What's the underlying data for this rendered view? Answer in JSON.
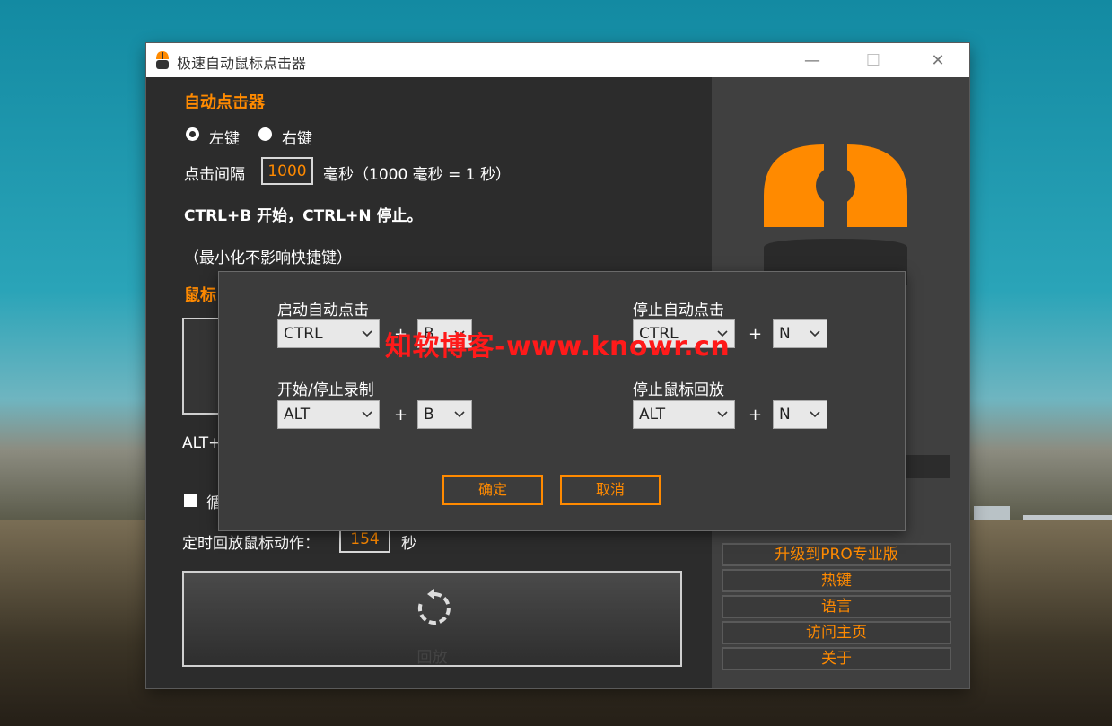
{
  "window": {
    "title": "极速自动鼠标点击器",
    "minimize": "—",
    "maximize": "☐",
    "close": "✕"
  },
  "autoclicker": {
    "heading": "自动点击器",
    "left_button": "左键",
    "right_button": "右键",
    "interval_label": "点击间隔",
    "interval_value": "1000",
    "interval_unit": "毫秒（1000 毫秒 = 1 秒）",
    "hotkey_text": "CTRL+B 开始，CTRL+N 停止。",
    "minimize_note": "（最小化不影响快捷键）"
  },
  "recorder": {
    "heading_partial": "鼠标",
    "hotkey_partial": "ALT+",
    "loop_partial": "循",
    "timed_label": "定时回放鼠标动作：",
    "timed_value": "154",
    "timed_unit": "秒",
    "replay_label": "回放"
  },
  "side_menu": {
    "items": [
      "升级到PRO专业版",
      "热键",
      "语言",
      "访问主页",
      "关于"
    ]
  },
  "dialog": {
    "start_auto_label": "启动自动点击",
    "start_auto_mod": "CTRL",
    "start_auto_key": "B",
    "stop_auto_label": "停止自动点击",
    "stop_auto_mod": "CTRL",
    "stop_auto_key": "N",
    "record_label": "开始/停止录制",
    "record_mod": "ALT",
    "record_key": "B",
    "stop_replay_label": "停止鼠标回放",
    "stop_replay_mod": "ALT",
    "stop_replay_key": "N",
    "plus": "+",
    "ok": "确定",
    "cancel": "取消",
    "watermark": "知软博客-www.knowr.cn"
  },
  "colors": {
    "accent": "#ff8a00",
    "panel": "#2c2c2c",
    "side": "#404040"
  }
}
